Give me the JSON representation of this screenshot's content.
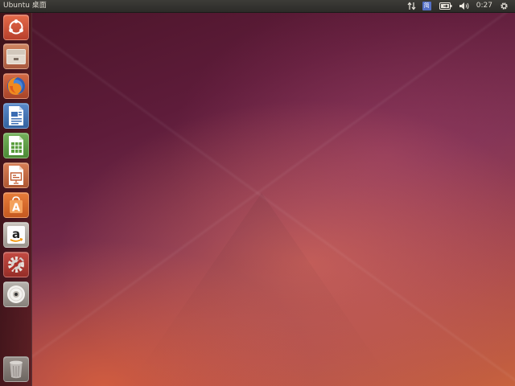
{
  "panel": {
    "title": "Ubuntu 桌面",
    "clock": "0:27",
    "input_method": "简",
    "icons": [
      "network-arrows-icon",
      "input-method-icon",
      "battery-icon",
      "volume-icon",
      "gear-icon"
    ]
  },
  "launcher": {
    "items": [
      {
        "icon": "dash-home-icon"
      },
      {
        "icon": "files-icon"
      },
      {
        "icon": "firefox-icon"
      },
      {
        "icon": "libreoffice-writer-icon"
      },
      {
        "icon": "libreoffice-calc-icon"
      },
      {
        "icon": "libreoffice-impress-icon"
      },
      {
        "icon": "software-center-icon"
      },
      {
        "icon": "amazon-icon"
      },
      {
        "icon": "system-settings-icon"
      },
      {
        "icon": "dvd-icon"
      },
      {
        "icon": "trash-icon"
      }
    ]
  },
  "colors": {
    "panel_bg": "#2c2b28",
    "panel_text": "#dfdbd2",
    "launcher_bg": "#4e181e",
    "wallpaper_top": "#4a1428",
    "wallpaper_bottom": "#c8623e"
  }
}
